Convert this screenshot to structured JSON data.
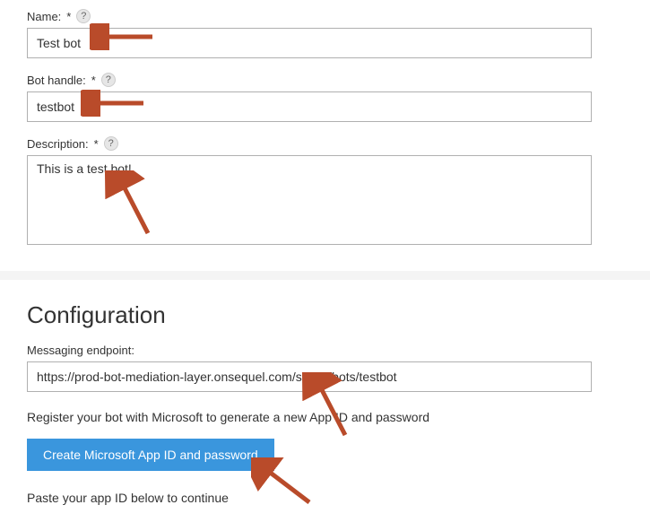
{
  "form": {
    "name": {
      "label": "Name:",
      "value": "Test bot"
    },
    "handle": {
      "label": "Bot handle:",
      "value": "testbot"
    },
    "description": {
      "label": "Description:",
      "value": "This is a test bot!"
    }
  },
  "config": {
    "heading": "Configuration",
    "endpoint_label": "Messaging endpoint:",
    "endpoint_value": "https://prod-bot-mediation-layer.onsequel.com/skype/bots/testbot",
    "register_text": "Register your bot with Microsoft to generate a new App ID and password",
    "button_label": "Create Microsoft App ID and password",
    "paste_text": "Paste your app ID below to continue"
  },
  "glyphs": {
    "required": "*",
    "help": "?"
  },
  "colors": {
    "arrow": "#b94b2a",
    "button_bg": "#3a96dd"
  }
}
